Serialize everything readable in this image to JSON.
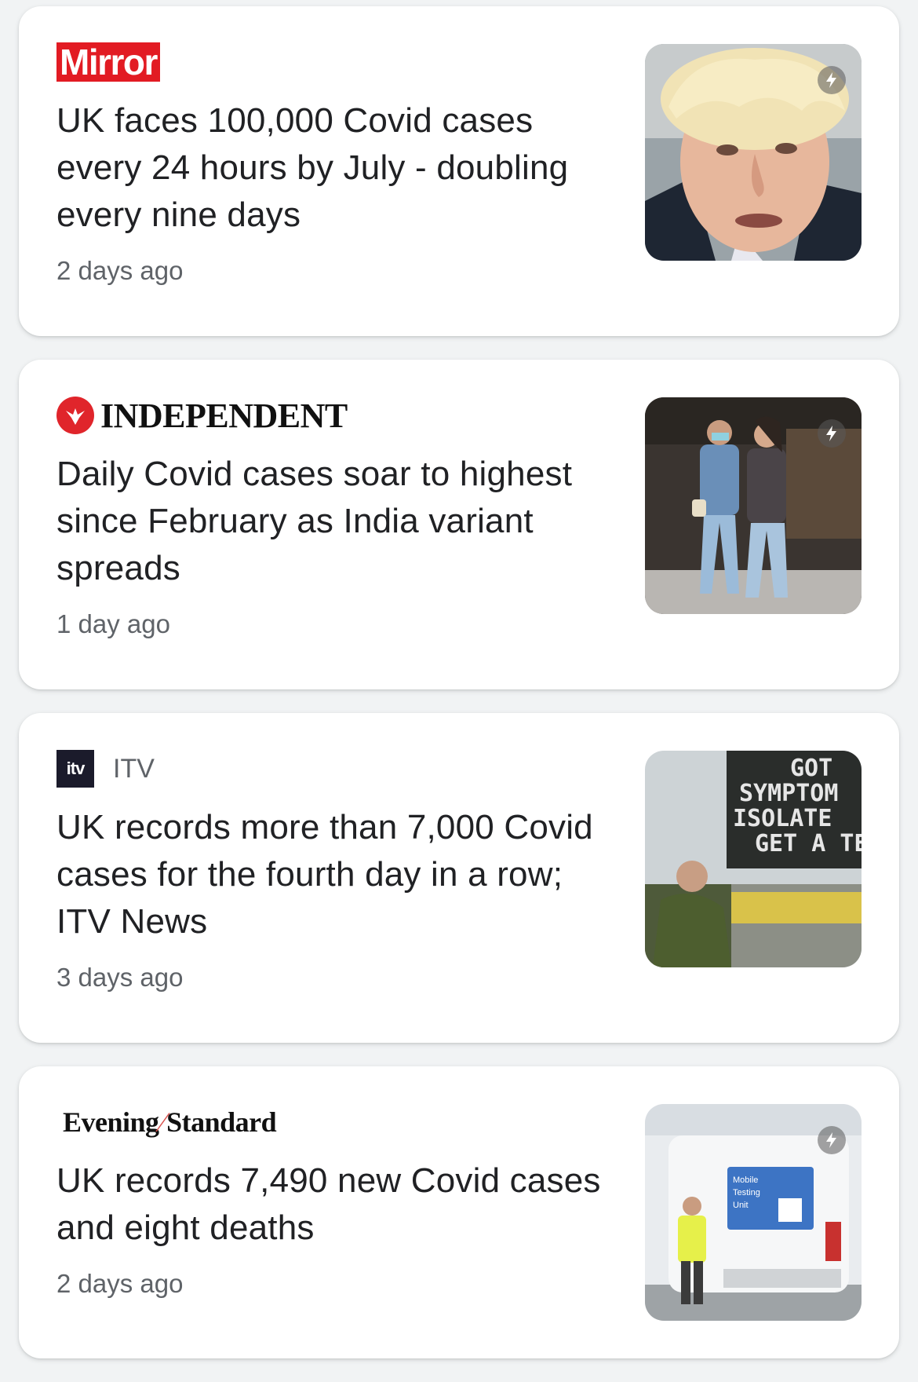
{
  "articles": [
    {
      "source": "Mirror",
      "source_logo_text": "Mirror",
      "headline": "UK faces 100,000 Covid cases every 24 hours by July - doubling every nine days",
      "time": "2 days ago",
      "thumbnail": "portrait of a man with blond hair",
      "amp_icon": "lightning-icon"
    },
    {
      "source": "Independent",
      "source_logo_text": "INDEPENDENT",
      "headline": "Daily Covid cases soar to highest since February as India variant spreads",
      "time": "1 day ago",
      "thumbnail": "two women in masks walking on a street",
      "amp_icon": "lightning-icon"
    },
    {
      "source": "ITV",
      "source_logo_text": "ITV",
      "source_icon_text": "itv",
      "headline": "UK records more than 7,000 Covid cases for the fourth day in a row; ITV News",
      "time": "3 days ago",
      "thumbnail": "sign reading GOT SYMPTOMS ISOLATE GET A TEST",
      "thumb_sign_lines": [
        "GOT",
        "SYMPTOM",
        "ISOLATE",
        "GET A TES"
      ]
    },
    {
      "source": "Evening Standard",
      "source_logo_left": "Evening",
      "source_logo_right": "Standard",
      "headline": "UK records 7,490 new Covid cases and eight deaths",
      "time": "2 days ago",
      "thumbnail": "mobile testing unit van with worker in hi-vis vest",
      "thumb_van_text": [
        "Mobile",
        "Testing",
        "Unit"
      ],
      "amp_icon": "lightning-icon"
    }
  ],
  "colors": {
    "mirror_red": "#e21b23",
    "independent_red": "#e0252b",
    "itv_dark": "#1b1b2b",
    "headline_text": "#202124",
    "meta_text": "#5f6368",
    "card_bg": "#ffffff",
    "page_bg": "#f1f3f4"
  }
}
